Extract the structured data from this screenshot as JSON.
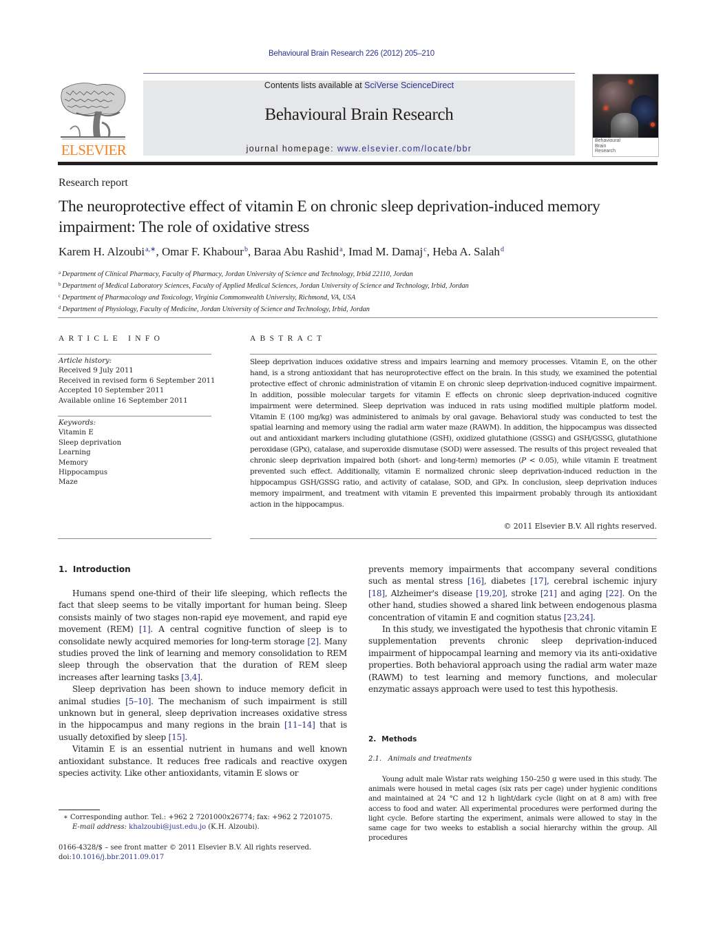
{
  "header": {
    "running_head": "Behavioural Brain Research 226 (2012) 205–210",
    "contents_prefix": "Contents lists available at ",
    "contents_link": "SciVerse ScienceDirect",
    "journal_name": "Behavioural Brain Research",
    "homepage_prefix": "journal homepage: ",
    "homepage_link": "www.elsevier.com/locate/bbr",
    "publisher_logo": "ELSEVIER",
    "logo_icon": "tree-icon",
    "cover_title_lines": [
      "Behavioural",
      "Brain",
      "Research"
    ]
  },
  "article": {
    "type": "Research report",
    "title": "The neuroprotective effect of vitamin E on chronic sleep deprivation-induced memory impairment: The role of oxidative stress",
    "authors": [
      {
        "name": "Karem H. Alzoubi",
        "sup": "a,∗",
        "sep": ", "
      },
      {
        "name": "Omar F. Khabour",
        "sup": "b",
        "sep": ", "
      },
      {
        "name": "Baraa Abu Rashid",
        "sup": "a",
        "sep": ", "
      },
      {
        "name": "Imad M. Damaj",
        "sup": "c",
        "sep": ", "
      },
      {
        "name": "Heba A. Salah",
        "sup": "d",
        "sep": ""
      }
    ],
    "affiliations": [
      {
        "mark": "a",
        "text": "Department of Clinical Pharmacy, Faculty of Pharmacy, Jordan University of Science and Technology, Irbid 22110, Jordan"
      },
      {
        "mark": "b",
        "text": "Department of Medical Laboratory Sciences, Faculty of Applied Medical Sciences, Jordan University of Science and Technology, Irbid, Jordan"
      },
      {
        "mark": "c",
        "text": "Department of Pharmacology and Toxicology, Virginia Commonwealth University, Richmond, VA, USA"
      },
      {
        "mark": "d",
        "text": "Department of Physiology, Faculty of Medicine, Jordan University of Science and Technology, Irbid, Jordan"
      }
    ]
  },
  "article_info": {
    "heading": "ARTICLE INFO",
    "history_label": "Article history:",
    "history": [
      "Received 9 July 2011",
      "Received in revised form 6 September 2011",
      "Accepted 10 September 2011",
      "Available online 16 September 2011"
    ],
    "keywords_label": "Keywords:",
    "keywords": [
      "Vitamin E",
      "Sleep deprivation",
      "Learning",
      "Memory",
      "Hippocampus",
      "Maze"
    ]
  },
  "abstract": {
    "heading": "ABSTRACT",
    "text_part1": "Sleep deprivation induces oxidative stress and impairs learning and memory processes. Vitamin E, on the other hand, is a strong antioxidant that has neuroprotective effect on the brain. In this study, we examined the potential protective effect of chronic administration of vitamin E on chronic sleep deprivation-induced cognitive impairment. In addition, possible molecular targets for vitamin E effects on chronic sleep deprivation-induced cognitive impairment were determined. Sleep deprivation was induced in rats using modified multiple platform model. Vitamin E (100 mg/kg) was administered to animals by oral gavage. Behavioral study was conducted to test the spatial learning and memory using the radial arm water maze (RAWM). In addition, the hippocampus was dissected out and antioxidant markers including glutathione (GSH), oxidized glutathione (GSSG) and GSH/GSSG, glutathione peroxidase (GPx), catalase, and superoxide dismutase (SOD) were assessed. The results of this project revealed that chronic sleep deprivation impaired both (short- and long-term) memories (",
    "p_symbol": "P",
    "text_part2": " < 0.05), while vitamin E treatment prevented such effect. Additionally, vitamin E normalized chronic sleep deprivation-induced reduction in the hippocampus GSH/GSSG ratio, and activity of catalase, SOD, and GPx. In conclusion, sleep deprivation induces memory impairment, and treatment with vitamin E prevented this impairment probably through its antioxidant action in the hippocampus.",
    "copyright": "© 2011 Elsevier B.V. All rights reserved."
  },
  "introduction": {
    "number": "1.",
    "title": "Introduction",
    "col1_paragraphs": [
      [
        {
          "t": "Humans spend one-third of their life sleeping, which reflects the fact that sleep seems to be vitally important for human being. Sleep consists mainly of two stages non-rapid eye movement, and rapid eye movement (REM) "
        },
        {
          "ref": "[1]"
        },
        {
          "t": ". A central cognitive function of sleep is to consolidate newly acquired memories for long-term storage "
        },
        {
          "ref": "[2]"
        },
        {
          "t": ". Many studies proved the link of learning and memory consolidation to REM sleep through the observation that the duration of REM sleep increases after learning tasks "
        },
        {
          "ref": "[3,4]"
        },
        {
          "t": "."
        }
      ],
      [
        {
          "t": "Sleep deprivation has been shown to induce memory deficit in animal studies "
        },
        {
          "ref": "[5–10]"
        },
        {
          "t": ". The mechanism of such impairment is still unknown but in general, sleep deprivation increases oxidative stress in the hippocampus and many regions in the brain "
        },
        {
          "ref": "[11–14]"
        },
        {
          "t": " that is usually detoxified by sleep "
        },
        {
          "ref": "[15]"
        },
        {
          "t": "."
        }
      ],
      [
        {
          "t": "Vitamin E is an essential nutrient in humans and well known antioxidant substance. It reduces free radicals and reactive oxygen species activity. Like other antioxidants, vitamin E slows or"
        }
      ]
    ],
    "col2_paragraphs": [
      [
        {
          "t": "prevents memory impairments that accompany several conditions such as mental stress "
        },
        {
          "ref": "[16]"
        },
        {
          "t": ", diabetes "
        },
        {
          "ref": "[17]"
        },
        {
          "t": ", cerebral ischemic injury "
        },
        {
          "ref": "[18]"
        },
        {
          "t": ", Alzheimer's disease "
        },
        {
          "ref": "[19,20]"
        },
        {
          "t": ", stroke "
        },
        {
          "ref": "[21]"
        },
        {
          "t": " and aging "
        },
        {
          "ref": "[22]"
        },
        {
          "t": ". On the other hand, studies showed a shared link between endogenous plasma concentration of vitamin E and cognition status "
        },
        {
          "ref": "[23,24]"
        },
        {
          "t": "."
        }
      ],
      [
        {
          "t": "In this study, we investigated the hypothesis that chronic vitamin E supplementation prevents chronic sleep deprivation-induced impairment of hippocampal learning and memory via its anti-oxidative properties. Both behavioral approach using the radial arm water maze (RAWM) to test learning and memory functions, and molecular enzymatic assays approach were used to test this hypothesis."
        }
      ]
    ]
  },
  "methods": {
    "number": "2.",
    "title": "Methods",
    "subsection_number": "2.1.",
    "subsection_title": "Animals and treatments",
    "text": "Young adult male Wistar rats weighing 150–250 g were used in this study. The animals were housed in metal cages (six rats per cage) under hygienic conditions and maintained at 24 °C and 12 h light/dark cycle (light on at 8 am) with free access to food and water. All experimental procedures were performed during the light cycle. Before starting the experiment, animals were allowed to stay in the same cage for two weeks to establish a social hierarchy within the group. All procedures"
  },
  "footnotes": {
    "corresponding_mark": "∗",
    "corresponding_text": "Corresponding author. Tel.: +962 2 7201000x26774; fax: +962 2 7201075.",
    "email_label": "E-mail address:",
    "email": "khalzoubi@just.edu.jo",
    "email_suffix": " (K.H. Alzoubi).",
    "front_matter": "0166-4328/$ – see front matter © 2011 Elsevier B.V. All rights reserved.",
    "doi_prefix": "doi:",
    "doi": "10.1016/j.bbr.2011.09.017"
  },
  "colors": {
    "link": "#2e3192",
    "elsevier_orange": "#f58220",
    "header_box": "#e6e7e8",
    "text": "#231f20"
  }
}
